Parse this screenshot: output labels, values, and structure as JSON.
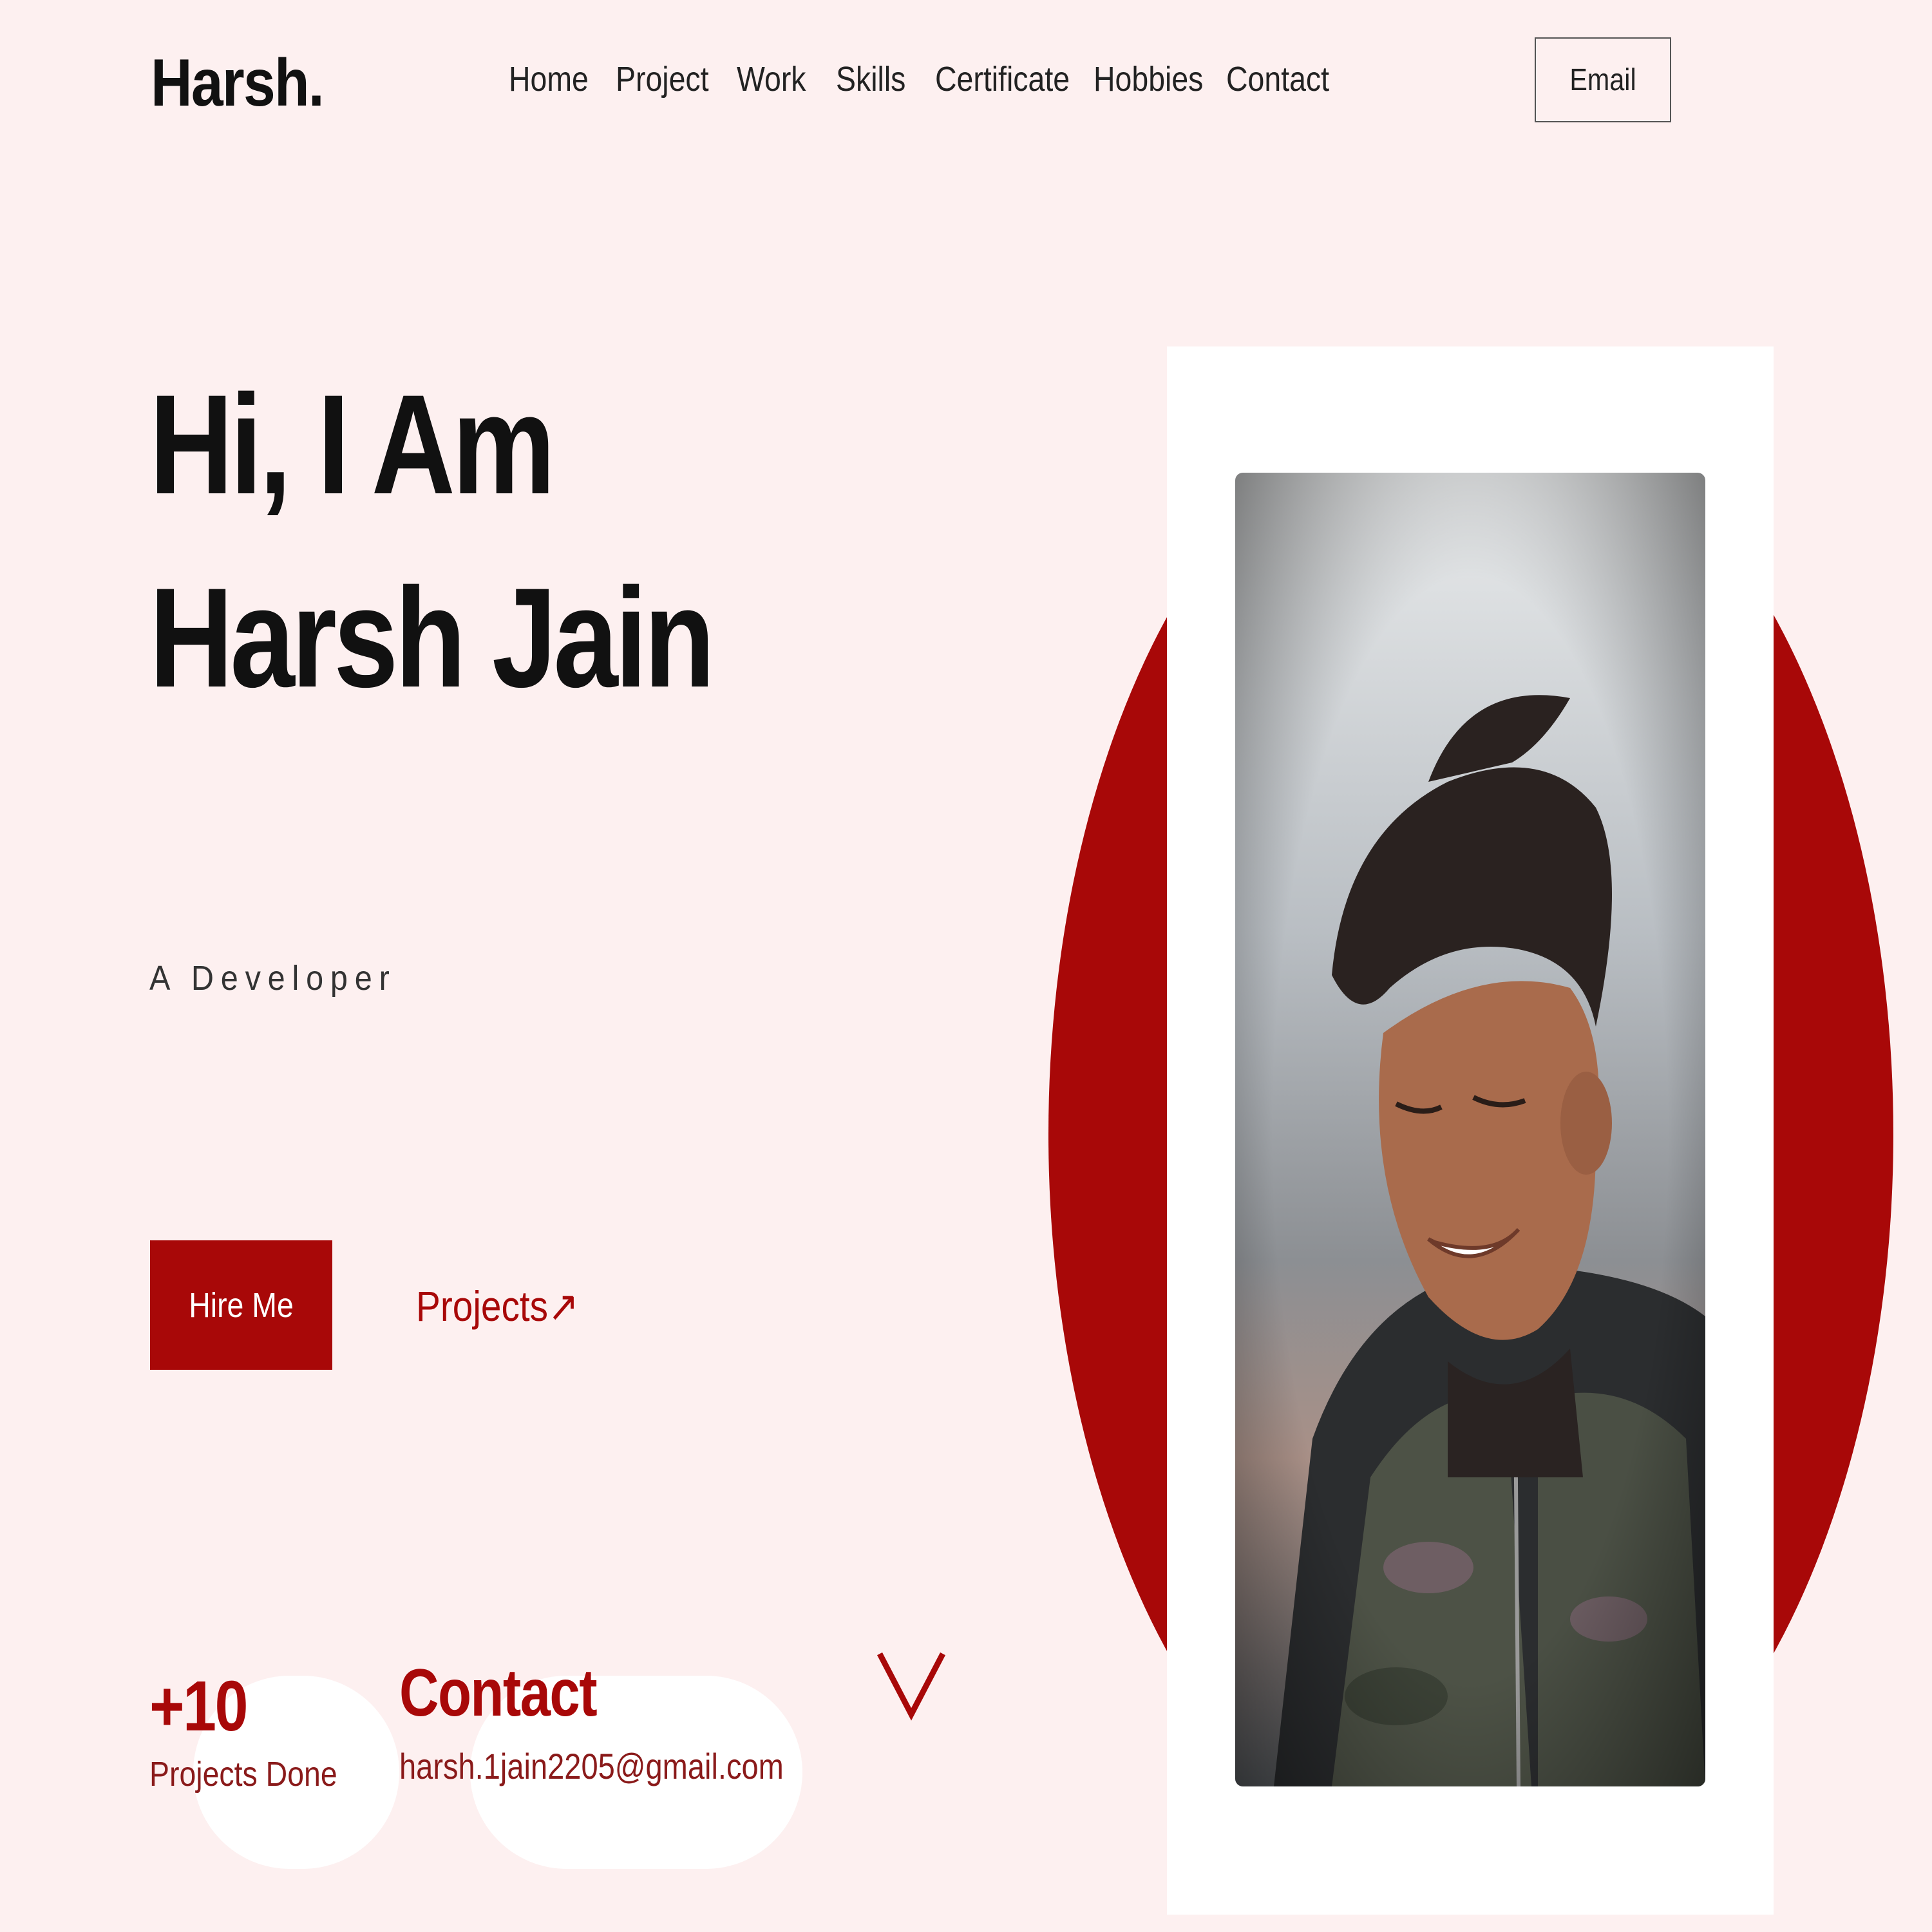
{
  "nav": {
    "logo": "Harsh.",
    "links": [
      "Home",
      "Project",
      "Work",
      "Skills",
      "Certificate",
      "Hobbies",
      "Contact"
    ],
    "email_button": "Email"
  },
  "hero": {
    "title_line1": "Hi, I Am",
    "title_line2": "Harsh Jain",
    "subtitle": "A Developer",
    "hire_button": "Hire Me",
    "projects_link": "Projects↗"
  },
  "stats": {
    "projects_count": "+10",
    "projects_label": "Projects Done",
    "contact_title": "Contact",
    "contact_email": "harsh.1jain2205@gmail.com"
  },
  "colors": {
    "accent": "#a80808",
    "background": "#fdf0f0"
  },
  "icons": {
    "scroll": "chevron-down-icon"
  }
}
